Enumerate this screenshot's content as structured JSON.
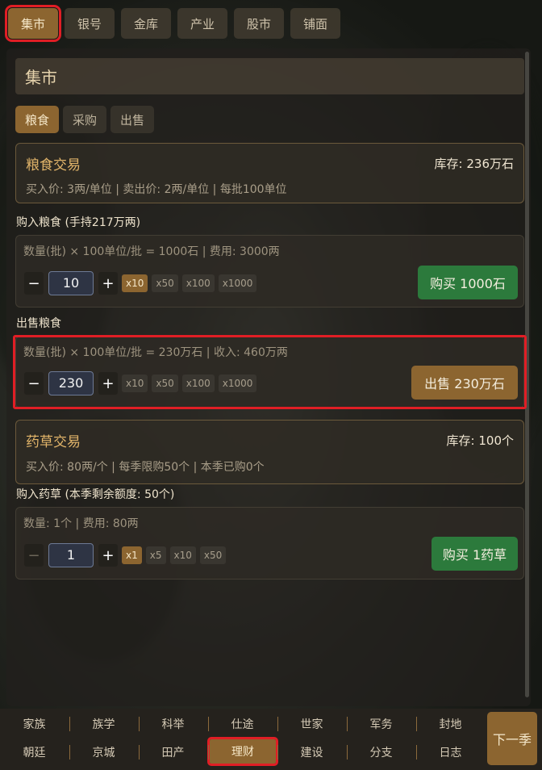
{
  "top_tabs": [
    "集市",
    "银号",
    "金库",
    "产业",
    "股市",
    "铺面"
  ],
  "panel_title": "集市",
  "subtabs": [
    "粮食",
    "采购",
    "出售"
  ],
  "grain": {
    "title": "粮食交易",
    "stock": "库存: 236万石",
    "prices": "买入价: 3两/单位 | 卖出价: 2两/单位 | 每批100单位",
    "buy_label": "购入粮食 (手持217万两)",
    "buy_info": "数量(批) × 100单位/批 = 1000石  |  费用: 3000两",
    "buy_qty": "10",
    "buy_mults": [
      "x10",
      "x50",
      "x100",
      "x1000"
    ],
    "buy_action": "购买 1000石",
    "sell_label": "出售粮食",
    "sell_info": "数量(批) × 100单位/批 = 230万石  |  收入: 460万两",
    "sell_qty": "230",
    "sell_mults": [
      "x10",
      "x50",
      "x100",
      "x1000"
    ],
    "sell_action": "出售 230万石"
  },
  "herb": {
    "title": "药草交易",
    "stock": "库存: 100个",
    "prices": "买入价: 80两/个 | 每季限购50个 | 本季已购0个",
    "buy_label": "购入药草 (本季剩余额度: 50个)",
    "buy_info": "数量: 1个  |  费用: 80两",
    "buy_qty": "1",
    "buy_mults": [
      "x1",
      "x5",
      "x10",
      "x50"
    ],
    "buy_action": "购买 1药草"
  },
  "stepper": {
    "minus": "−",
    "plus": "+"
  },
  "bottom_nav": {
    "row1": [
      "家族",
      "族学",
      "科举",
      "仕途",
      "世家",
      "军务",
      "封地"
    ],
    "row2": [
      "朝廷",
      "京城",
      "田产",
      "理财",
      "建设",
      "分支",
      "日志"
    ],
    "next_season": "下一季"
  }
}
